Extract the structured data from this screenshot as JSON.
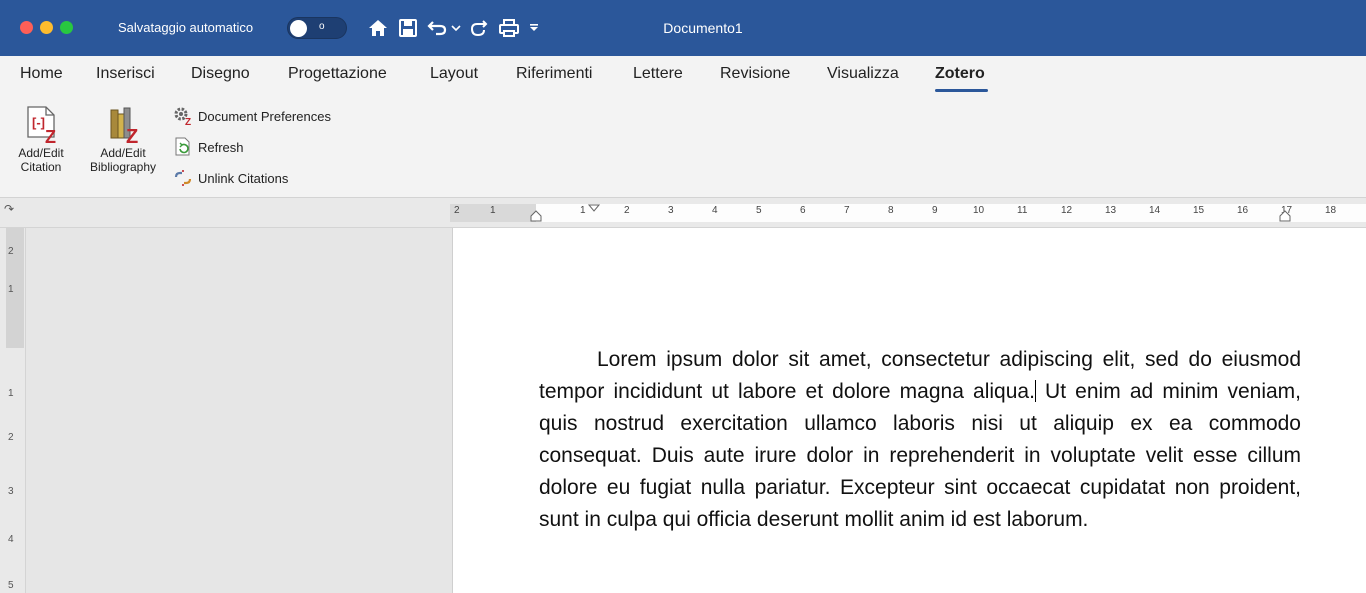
{
  "titlebar": {
    "autosave_label": "Salvataggio automatico",
    "autosave_state": "o",
    "document_title": "Documento1",
    "icons": [
      "home-icon",
      "save-icon",
      "undo-icon",
      "chevron-down-icon",
      "redo-icon",
      "print-icon",
      "customize-toolbar-icon"
    ]
  },
  "tabs": [
    "Home",
    "Inserisci",
    "Disegno",
    "Progettazione",
    "Layout",
    "Riferimenti",
    "Lettere",
    "Revisione",
    "Visualizza",
    "Zotero"
  ],
  "active_tab": "Zotero",
  "ribbon": {
    "add_edit_citation_line1": "Add/Edit",
    "add_edit_citation_line2": "Citation",
    "add_edit_bibliography_line1": "Add/Edit",
    "add_edit_bibliography_line2": "Bibliography",
    "document_preferences": "Document Preferences",
    "refresh": "Refresh",
    "unlink_citations": "Unlink Citations"
  },
  "ruler": {
    "numbers": [
      "2",
      "1",
      "1",
      "2",
      "3",
      "4",
      "5",
      "6",
      "7",
      "8",
      "9",
      "10",
      "11",
      "12",
      "13",
      "14",
      "15",
      "16",
      "17",
      "18"
    ]
  },
  "vruler": {
    "numbers": [
      "2",
      "1",
      "1",
      "2",
      "3",
      "4",
      "5"
    ]
  },
  "document": {
    "text_before_caret": "Lorem ipsum dolor sit amet, consectetur adipiscing elit, sed do eiusmod tempor incididunt ut labore et dolore magna aliqua.",
    "text_after_caret": " Ut enim ad minim veniam, quis nostrud exercitation ullamco laboris nisi ut aliquip ex ea commodo consequat. Duis aute irure dolor in reprehenderit in voluptate velit esse cillum dolore eu fugiat nulla pariatur. Excepteur sint occaecat cupidatat non proident, sunt in culpa qui officia deserunt mollit anim id est laborum."
  },
  "colors": {
    "accent": "#2b579a",
    "ribbon_bg": "#f3f3f3",
    "zotero_red": "#c0262d"
  }
}
